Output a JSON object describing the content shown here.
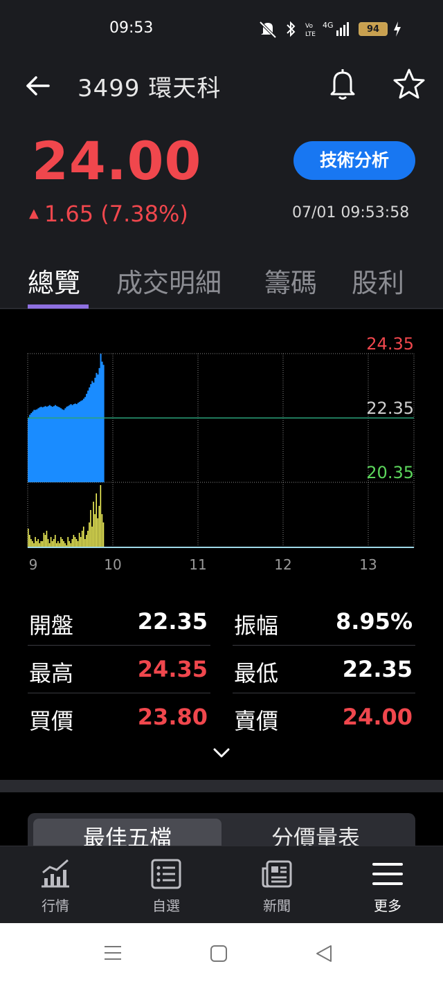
{
  "status_bar": {
    "time": "09:53",
    "battery": "94",
    "signal": "4G",
    "icons": [
      "mute-icon",
      "bluetooth-icon",
      "volte-icon",
      "signal-icon",
      "battery-icon",
      "charging-icon"
    ]
  },
  "header": {
    "title": "3499 環天科",
    "icons": [
      "back-arrow-icon",
      "bell-icon",
      "star-icon"
    ]
  },
  "quote": {
    "price": "24.00",
    "change": "1.65 (7.38%)",
    "datetime": "07/01 09:53:58",
    "tech_button": "技術分析",
    "up_color": "#f0474d"
  },
  "tabs": [
    {
      "label": "總覽",
      "active": true
    },
    {
      "label": "成交明細",
      "active": false
    },
    {
      "label": "籌碼",
      "active": false
    },
    {
      "label": "股利",
      "active": false
    }
  ],
  "chart_data": {
    "type": "area",
    "y_labels": {
      "high": "24.35",
      "ref": "22.35",
      "low": "20.35"
    },
    "ylim": [
      20.35,
      24.35
    ],
    "reference_price": 22.35,
    "x_tick_labels": [
      "9",
      "10",
      "11",
      "12",
      "13"
    ],
    "x": [
      "9:00",
      "9:01",
      "9:02",
      "9:03",
      "9:04",
      "9:05",
      "9:06",
      "9:07",
      "9:08",
      "9:09",
      "9:10",
      "9:11",
      "9:12",
      "9:13",
      "9:14",
      "9:15",
      "9:16",
      "9:17",
      "9:18",
      "9:19",
      "9:20",
      "9:21",
      "9:22",
      "9:23",
      "9:24",
      "9:25",
      "9:26",
      "9:27",
      "9:28",
      "9:29",
      "9:30",
      "9:31",
      "9:32",
      "9:33",
      "9:34",
      "9:35",
      "9:36",
      "9:37",
      "9:38",
      "9:39",
      "9:40",
      "9:41",
      "9:42",
      "9:43",
      "9:44",
      "9:45",
      "9:46",
      "9:47",
      "9:48",
      "9:49",
      "9:50",
      "9:51",
      "9:52",
      "9:53"
    ],
    "price_series": [
      22.35,
      22.45,
      22.5,
      22.55,
      22.6,
      22.6,
      22.62,
      22.65,
      22.68,
      22.7,
      22.68,
      22.7,
      22.72,
      22.7,
      22.72,
      22.75,
      22.72,
      22.7,
      22.72,
      22.75,
      22.72,
      22.7,
      22.68,
      22.65,
      22.62,
      22.6,
      22.65,
      22.7,
      22.72,
      22.75,
      22.78,
      22.75,
      22.78,
      22.8,
      22.78,
      22.82,
      22.85,
      22.88,
      22.9,
      22.95,
      23.0,
      23.1,
      23.2,
      23.3,
      23.4,
      23.5,
      23.45,
      23.6,
      23.75,
      23.7,
      23.9,
      24.35,
      24.1,
      24.0
    ],
    "volume_series": [
      9,
      6,
      4,
      3,
      2,
      5,
      3,
      4,
      2,
      3,
      3,
      7,
      6,
      8,
      4,
      2,
      5,
      3,
      4,
      6,
      2,
      3,
      2,
      5,
      4,
      3,
      2,
      1,
      5,
      3,
      2,
      4,
      6,
      5,
      4,
      3,
      7,
      5,
      8,
      10,
      4,
      6,
      8,
      12,
      18,
      10,
      22,
      16,
      26,
      14,
      20,
      30,
      16,
      12
    ],
    "volume_max": 30,
    "price_color": "#1a8cff",
    "volume_color": "#f3f35a",
    "high_label_color": "#f0474d",
    "ref_label_color": "#d0d0d0",
    "low_label_color": "#5cd65c"
  },
  "stats": {
    "open_label": "開盤",
    "open_value": "22.35",
    "amplitude_label": "振幅",
    "amplitude_value": "8.95%",
    "high_label": "最高",
    "high_value": "24.35",
    "low_label": "最低",
    "low_value": "22.35",
    "bid_label": "買價",
    "bid_value": "23.80",
    "ask_label": "賣價",
    "ask_value": "24.00"
  },
  "segments": {
    "best_five": "最佳五檔",
    "price_volume": "分價量表"
  },
  "bottom_nav": [
    {
      "label": "行情",
      "icon": "chart-icon",
      "active": false
    },
    {
      "label": "自選",
      "icon": "list-icon",
      "active": false
    },
    {
      "label": "新聞",
      "icon": "news-icon",
      "active": false
    },
    {
      "label": "更多",
      "icon": "menu-icon",
      "active": true
    }
  ]
}
